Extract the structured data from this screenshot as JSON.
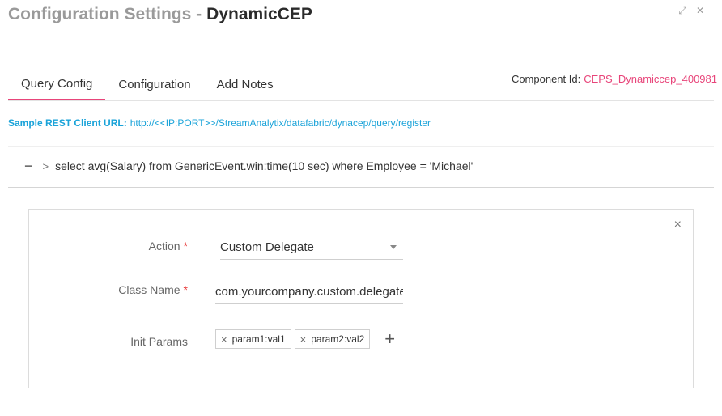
{
  "window": {
    "title_prefix": "Configuration Settings -",
    "title_name": "DynamicCEP",
    "expand_icon": "⤢",
    "close_icon": "✕"
  },
  "tabs": [
    {
      "label": "Query Config",
      "active": true
    },
    {
      "label": "Configuration",
      "active": false
    },
    {
      "label": "Add Notes",
      "active": false
    }
  ],
  "component": {
    "label": "Component Id:",
    "value": "CEPS_Dynamiccep_400981"
  },
  "rest": {
    "label": "Sample REST Client URL:",
    "url": "http://<<IP:PORT>>/StreamAnalytix/datafabric/dynacep/query/register"
  },
  "query": {
    "collapse_icon": "−",
    "chevron_icon": ">",
    "text": "select avg(Salary) from GenericEvent.win:time(10 sec) where Employee = 'Michael'"
  },
  "form": {
    "close_icon": "×",
    "action_label": "Action",
    "action_value": "Custom Delegate",
    "class_label": "Class Name",
    "class_value": "com.yourcompany.custom.delegate",
    "params_label": "Init Params",
    "required_mark": "*",
    "params": [
      "param1:val1",
      "param2:val2"
    ],
    "chip_remove_icon": "×",
    "add_icon": "+"
  }
}
